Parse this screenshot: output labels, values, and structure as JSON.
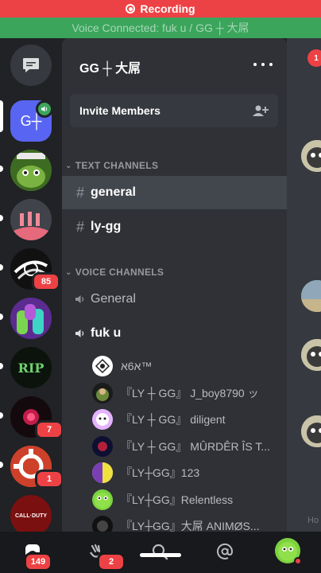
{
  "banners": {
    "recording": "Recording",
    "voice_connected": "Voice Connected: fuk u / GG ┼ 大屌"
  },
  "server": {
    "name": "GG ┼ 大屌",
    "invite_label": "Invite Members",
    "icon_text": "G┼"
  },
  "guilds": [
    {
      "badge": ""
    },
    {
      "badge": ""
    },
    {
      "badge": ""
    },
    {
      "badge": "85"
    },
    {
      "badge": ""
    },
    {
      "badge": ""
    },
    {
      "badge": "7"
    },
    {
      "badge": "1"
    },
    {
      "badge": ""
    }
  ],
  "guild_icon_text": {
    "rip": "RIP",
    "codm": "CALL·DUTY"
  },
  "categories": {
    "text": "TEXT CHANNELS",
    "voice": "VOICE CHANNELS"
  },
  "text_channels": [
    {
      "name": "general"
    },
    {
      "name": "ly-gg"
    }
  ],
  "voice_channels": [
    {
      "name": "General"
    },
    {
      "name": "fuk u"
    }
  ],
  "voice_users": [
    {
      "name": "א6א™"
    },
    {
      "name": "『LY ┼ GG』 J_boy8790 ッ"
    },
    {
      "name": "『LY ┼ GG』 diligent"
    },
    {
      "name": "『LY ┼ GG』 MÛRDÊR ÎS T..."
    },
    {
      "name": "『LY┼GG』123"
    },
    {
      "name": "『LY┼GG』Relentless"
    },
    {
      "name": "『LY┼GG』大屌 ANIMØS..."
    }
  ],
  "peek": {
    "unread": "1",
    "how_text": "Ho"
  },
  "bottom_nav": {
    "home_badge": "149",
    "friends_badge": "2"
  },
  "colors": {
    "recording_red": "#ed4245",
    "voice_green": "#3ba55c",
    "blurple": "#5865f2"
  }
}
